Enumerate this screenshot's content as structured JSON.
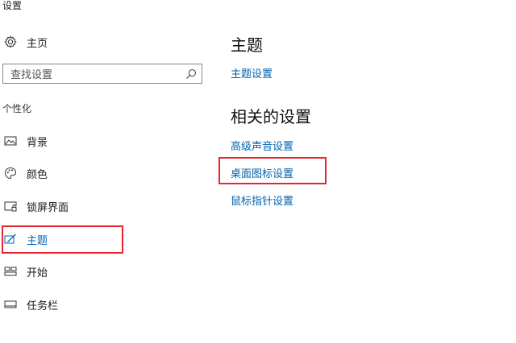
{
  "window": {
    "title": "设置"
  },
  "sidebar": {
    "home": {
      "label": "主页",
      "icon": "gear-icon"
    },
    "search": {
      "placeholder": "查找设置",
      "icon": "search-icon"
    },
    "section_label": "个性化",
    "items": [
      {
        "label": "背景",
        "icon": "picture-icon",
        "active": false
      },
      {
        "label": "颜色",
        "icon": "palette-icon",
        "active": false
      },
      {
        "label": "锁屏界面",
        "icon": "lock-screen-icon",
        "active": false
      },
      {
        "label": "主题",
        "icon": "theme-brush-icon",
        "active": true
      },
      {
        "label": "开始",
        "icon": "start-menu-icon",
        "active": false
      },
      {
        "label": "任务栏",
        "icon": "taskbar-icon",
        "active": false
      }
    ]
  },
  "main": {
    "theme_heading": "主题",
    "theme_settings_link": "主题设置",
    "related_heading": "相关的设置",
    "related_links": [
      "高级声音设置",
      "桌面图标设置",
      "鼠标指针设置"
    ]
  },
  "colors": {
    "accent": "#0063b1",
    "highlight_border": "#e8232b"
  }
}
